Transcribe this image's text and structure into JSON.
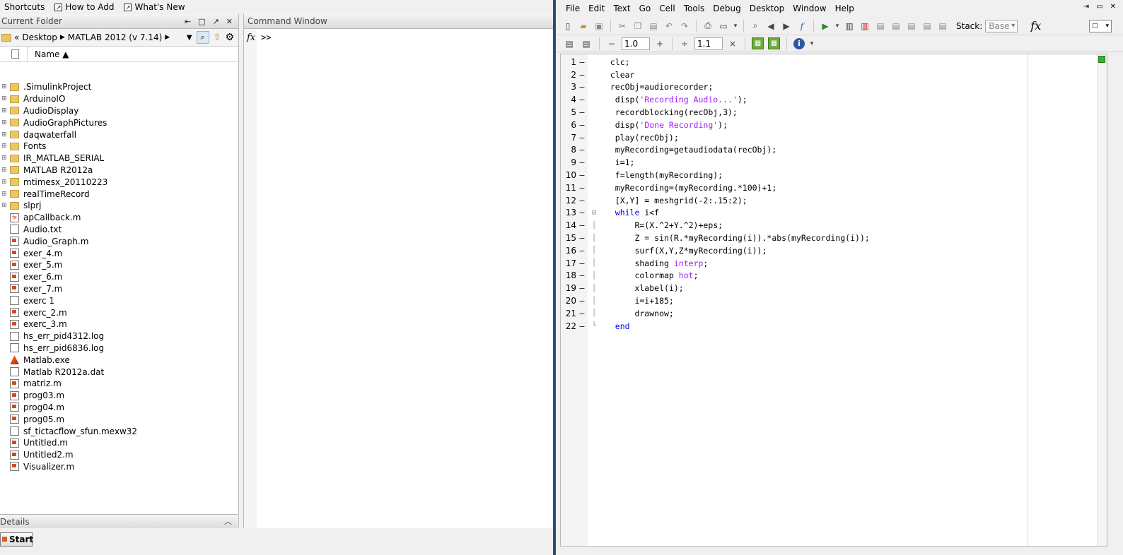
{
  "shortcuts": {
    "items": [
      {
        "label": "Shortcuts"
      },
      {
        "label": "How to Add"
      },
      {
        "label": "What's New"
      }
    ]
  },
  "current_folder": {
    "title": "Current Folder",
    "breadcrumb": [
      "«",
      "Desktop",
      "MATLAB 2012 (v 7.14)"
    ],
    "column_name": "Name ▲",
    "files": [
      {
        "name": ".SimulinkProject",
        "type": "folder"
      },
      {
        "name": "ArduinoIO",
        "type": "folder"
      },
      {
        "name": "AudioDisplay",
        "type": "folder"
      },
      {
        "name": "AudioGraphPictures",
        "type": "folder"
      },
      {
        "name": "daqwaterfall",
        "type": "folder"
      },
      {
        "name": "Fonts",
        "type": "folder"
      },
      {
        "name": "IR_MATLAB_SERIAL",
        "type": "folder"
      },
      {
        "name": "MATLAB R2012a",
        "type": "folder"
      },
      {
        "name": "mtimesx_20110223",
        "type": "folder"
      },
      {
        "name": "realTimeRecord",
        "type": "folder"
      },
      {
        "name": "slprj",
        "type": "folder"
      },
      {
        "name": "apCallback.m",
        "type": "fx"
      },
      {
        "name": "Audio.txt",
        "type": "file"
      },
      {
        "name": "Audio_Graph.m",
        "type": "mfile"
      },
      {
        "name": "exer_4.m",
        "type": "mfile"
      },
      {
        "name": "exer_5.m",
        "type": "mfile"
      },
      {
        "name": "exer_6.m",
        "type": "mfile"
      },
      {
        "name": "exer_7.m",
        "type": "mfile"
      },
      {
        "name": "exerc 1",
        "type": "file"
      },
      {
        "name": "exerc_2.m",
        "type": "mfile"
      },
      {
        "name": "exerc_3.m",
        "type": "mfile"
      },
      {
        "name": "hs_err_pid4312.log",
        "type": "file"
      },
      {
        "name": "hs_err_pid6836.log",
        "type": "file"
      },
      {
        "name": "Matlab.exe",
        "type": "exe"
      },
      {
        "name": "Matlab R2012a.dat",
        "type": "file"
      },
      {
        "name": "matriz.m",
        "type": "mfile"
      },
      {
        "name": "prog03.m",
        "type": "mfile"
      },
      {
        "name": "prog04.m",
        "type": "mfile"
      },
      {
        "name": "prog05.m",
        "type": "mfile"
      },
      {
        "name": "sf_tictacflow_sfun.mexw32",
        "type": "file"
      },
      {
        "name": "Untitled.m",
        "type": "mfile"
      },
      {
        "name": "Untitled2.m",
        "type": "mfile"
      },
      {
        "name": "Visualizer.m",
        "type": "mfile"
      }
    ],
    "details_label": "Details"
  },
  "command_window": {
    "title": "Command Window",
    "prompt": ">>"
  },
  "taskbar": {
    "start_label": "Start"
  },
  "editor": {
    "menu": [
      "File",
      "Edit",
      "Text",
      "Go",
      "Cell",
      "Tools",
      "Debug",
      "Desktop",
      "Window",
      "Help"
    ],
    "stack_label": "Stack:",
    "stack_value": "Base",
    "cell_minus": "−",
    "cell_value_1": "1.0",
    "cell_plus": "+",
    "cell_divide": "÷",
    "cell_value_2": "1.1",
    "cell_times": "×",
    "code_lines": [
      [
        {
          "t": "  clc;"
        }
      ],
      [
        {
          "t": "  clear"
        }
      ],
      [
        {
          "t": "  recObj=audiorecorder;"
        }
      ],
      [
        {
          "t": "   disp("
        },
        {
          "t": "'Recording Audio...'",
          "c": "str"
        },
        {
          "t": ");"
        }
      ],
      [
        {
          "t": "   recordblocking(recObj,3);"
        }
      ],
      [
        {
          "t": "   disp("
        },
        {
          "t": "'Done Recording'",
          "c": "str"
        },
        {
          "t": ");"
        }
      ],
      [
        {
          "t": "   play(recObj);"
        }
      ],
      [
        {
          "t": "   myRecording=getaudiodata(recObj);"
        }
      ],
      [
        {
          "t": "   i=1;"
        }
      ],
      [
        {
          "t": "   f=length(myRecording);"
        }
      ],
      [
        {
          "t": "   myRecording=(myRecording.*100)+1;"
        }
      ],
      [
        {
          "t": "   [X,Y] = meshgrid(-2:.15:2);"
        }
      ],
      [
        {
          "t": "   "
        },
        {
          "t": "while",
          "c": "kw"
        },
        {
          "t": " i<f"
        }
      ],
      [
        {
          "t": "       R=(X.^2+Y.^2)+eps;"
        }
      ],
      [
        {
          "t": "       Z = sin(R.*myRecording(i)).*abs(myRecording(i));"
        }
      ],
      [
        {
          "t": "       surf(X,Y,Z*myRecording(i));"
        }
      ],
      [
        {
          "t": "       shading "
        },
        {
          "t": "interp",
          "c": "str"
        },
        {
          "t": ";"
        }
      ],
      [
        {
          "t": "       colormap "
        },
        {
          "t": "hot",
          "c": "str"
        },
        {
          "t": ";"
        }
      ],
      [
        {
          "t": "       xlabel(i);"
        }
      ],
      [
        {
          "t": "       i=i+185;"
        }
      ],
      [
        {
          "t": "       drawnow;"
        }
      ],
      [
        {
          "t": "   "
        },
        {
          "t": "end",
          "c": "kw"
        }
      ]
    ]
  }
}
